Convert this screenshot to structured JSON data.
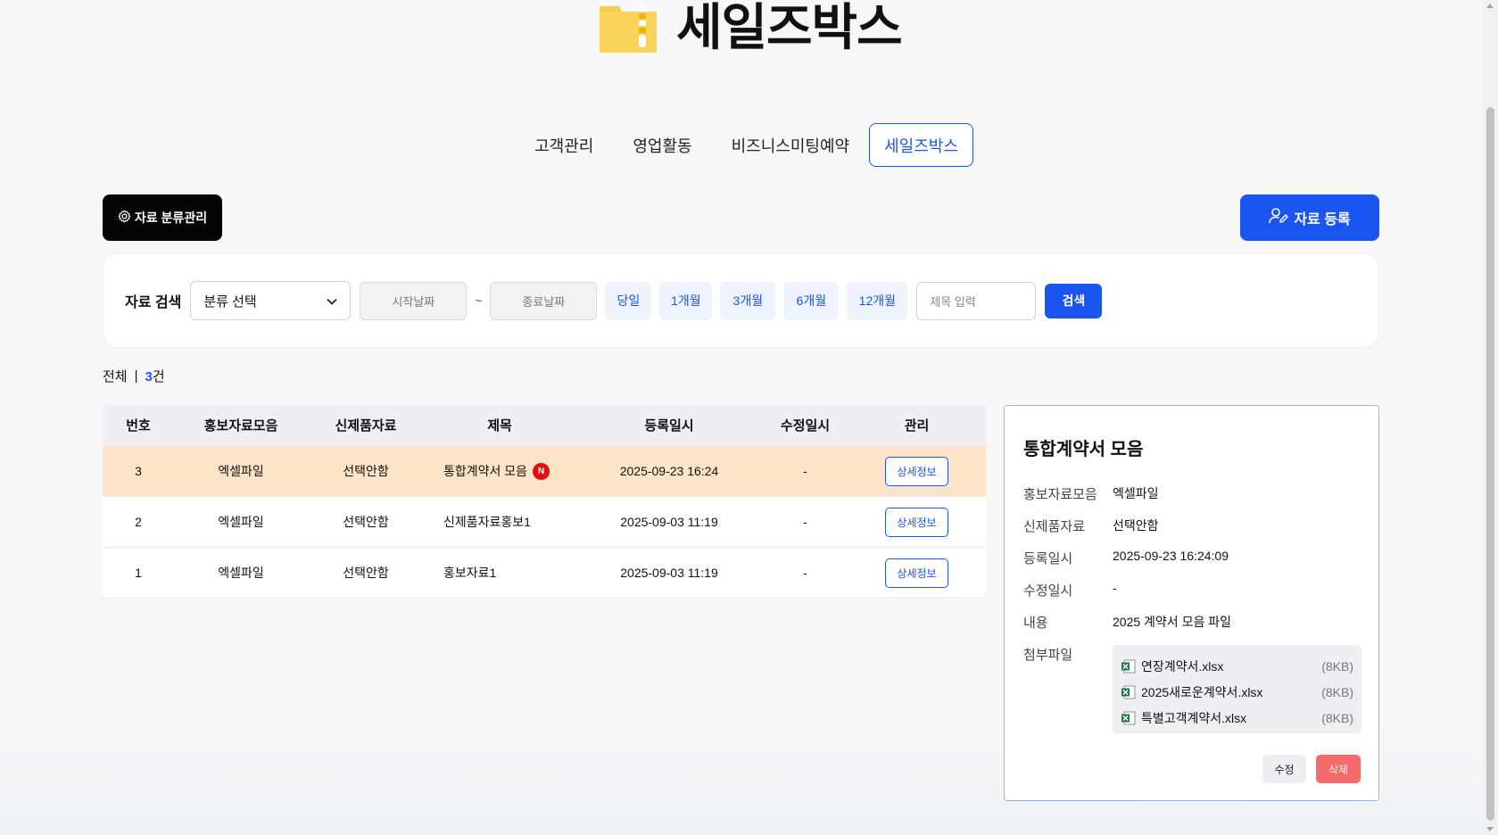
{
  "header": {
    "title": "세일즈박스",
    "logo_icon": "zip-folder-icon",
    "logo_color": "#f7cc4e"
  },
  "tabs": [
    {
      "label": "고객관리",
      "active": false
    },
    {
      "label": "영업활동",
      "active": false
    },
    {
      "label": "비즈니스미팅예약",
      "active": false
    },
    {
      "label": "세일즈박스",
      "active": true
    }
  ],
  "actions": {
    "category_label": "자료 분류관리",
    "register_label": "자료 등록"
  },
  "search": {
    "label": "자료 검색",
    "category_value": "분류 선택",
    "start_placeholder": "시작날짜",
    "tilde": "~",
    "end_placeholder": "종료날짜",
    "periods": [
      "당일",
      "1개월",
      "3개월",
      "6개월",
      "12개월"
    ],
    "title_placeholder": "제목 입력",
    "search_label": "검색"
  },
  "count": {
    "label": "전체",
    "separator": "|",
    "value": "3",
    "unit": "건"
  },
  "table": {
    "headers": [
      "번호",
      "홍보자료모음",
      "신제품자료",
      "제목",
      "등록일시",
      "수정일시",
      "관리"
    ],
    "rows": [
      {
        "no": "3",
        "promo": "엑셀파일",
        "newprod": "선택안함",
        "title": "통합계약서 모음",
        "badge": "N",
        "created": "2025-09-23 16:24",
        "modified": "-",
        "action": "상세정보",
        "highlight": true
      },
      {
        "no": "2",
        "promo": "엑셀파일",
        "newprod": "선택안함",
        "title": "신제품자료홍보1",
        "badge": "",
        "created": "2025-09-03 11:19",
        "modified": "-",
        "action": "상세정보",
        "highlight": false
      },
      {
        "no": "1",
        "promo": "엑셀파일",
        "newprod": "선택안함",
        "title": "홍보자료1",
        "badge": "",
        "created": "2025-09-03 11:19",
        "modified": "-",
        "action": "상세정보",
        "highlight": false
      }
    ]
  },
  "detail": {
    "title": "통합계약서 모음",
    "fields": [
      {
        "label": "홍보자료모음",
        "value": "엑셀파일"
      },
      {
        "label": "신제품자료",
        "value": "선택안함"
      },
      {
        "label": "등록일시",
        "value": "2025-09-23 16:24:09"
      },
      {
        "label": "수정일시",
        "value": "-"
      },
      {
        "label": "내용",
        "value": "2025 계약서 모음 파일"
      }
    ],
    "files_label": "첨부파일",
    "files": [
      {
        "name": "연장계약서.xlsx",
        "size": "(8KB)",
        "icon": "excel-file-icon"
      },
      {
        "name": "2025새로운계약서.xlsx",
        "size": "(8KB)",
        "icon": "excel-file-icon"
      },
      {
        "name": "특별고객계약서.xlsx",
        "size": "(8KB)",
        "icon": "excel-file-icon"
      }
    ],
    "edit_label": "수정",
    "delete_label": "삭제"
  },
  "colors": {
    "accent": "#1a55f0",
    "highlight_row": "#fde4c8",
    "danger": "#f36b6b",
    "badge": "#e50b0b"
  }
}
